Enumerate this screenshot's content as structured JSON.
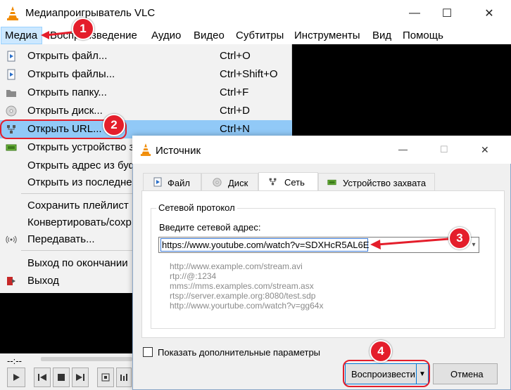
{
  "window": {
    "title": "Медиапроигрыватель VLC",
    "min_glyph": "—",
    "max_glyph": "☐",
    "close_glyph": "✕"
  },
  "menubar": {
    "items": [
      "Медиа",
      "Воспроизведение",
      "Аудио",
      "Видео",
      "Субтитры",
      "Инструменты",
      "Вид",
      "Помощь"
    ]
  },
  "media_menu": {
    "items": [
      {
        "label": "Открыть файл...",
        "shortcut": "Ctrl+O",
        "icon": "file-play-icon"
      },
      {
        "label": "Открыть файлы...",
        "shortcut": "Ctrl+Shift+O",
        "icon": "files-play-icon"
      },
      {
        "label": "Открыть папку...",
        "shortcut": "Ctrl+F",
        "icon": "folder-icon"
      },
      {
        "label": "Открыть диск...",
        "shortcut": "Ctrl+D",
        "icon": "disc-icon"
      },
      {
        "label": "Открыть URL...",
        "shortcut": "Ctrl+N",
        "icon": "network-icon"
      },
      {
        "label": "Открыть устройство з",
        "shortcut": "",
        "icon": "capture-device-icon"
      },
      {
        "label": "Открыть адрес из буф",
        "shortcut": "",
        "icon": ""
      },
      {
        "label": "Открыть из последне",
        "shortcut": "",
        "icon": ""
      },
      {
        "label": "Сохранить плейлист",
        "shortcut": "",
        "icon": ""
      },
      {
        "label": "Конвертировать/сохр",
        "shortcut": "",
        "icon": ""
      },
      {
        "label": "Передавать...",
        "shortcut": "",
        "icon": "stream-icon"
      },
      {
        "label": "Выход по окончании",
        "shortcut": "",
        "icon": ""
      },
      {
        "label": "Выход",
        "shortcut": "",
        "icon": "exit-icon"
      }
    ]
  },
  "controls": {
    "time": "--:--"
  },
  "dialog": {
    "title": "Источник",
    "tabs": [
      "Файл",
      "Диск",
      "Сеть",
      "Устройство захвата"
    ],
    "active_tab": "Сеть",
    "group_title": "Сетевой протокол",
    "address_label": "Введите сетевой адрес:",
    "address_value": "https://www.youtube.com/watch?v=SDXHcR5AL6E",
    "examples": [
      "http://www.example.com/stream.avi",
      "rtp://@:1234",
      "mms://mms.examples.com/stream.asx",
      "rtsp://server.example.org:8080/test.sdp",
      "http://www.yourtube.com/watch?v=gg64x"
    ],
    "show_more_label": "Показать дополнительные параметры",
    "play_label": "Воспроизвести",
    "cancel_label": "Отмена"
  },
  "annotations": {
    "badges": [
      "1",
      "2",
      "3",
      "4"
    ],
    "color": "#e41e2b"
  },
  "colors": {
    "highlight": "#91c9f7",
    "menu_selected": "#cce8ff",
    "vlc_orange": "#f08a00"
  }
}
